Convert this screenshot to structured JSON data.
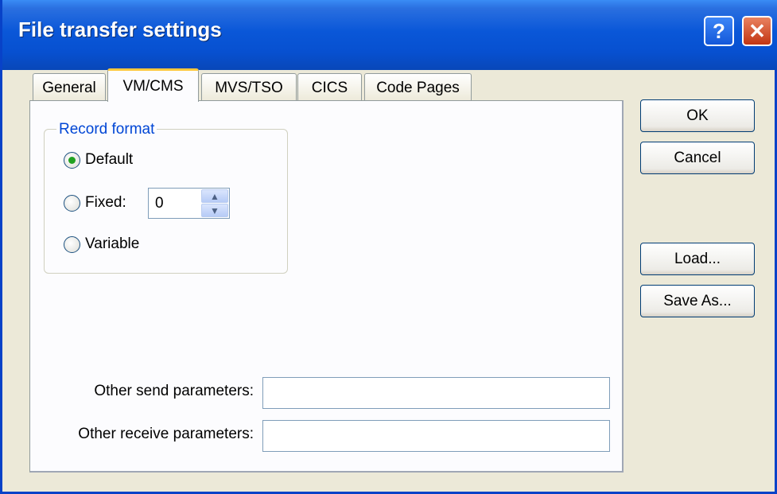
{
  "window": {
    "title": "File transfer settings"
  },
  "titlebar_buttons": {
    "help": "?",
    "close": "✕"
  },
  "tabs": [
    {
      "label": "General"
    },
    {
      "label": "VM/CMS"
    },
    {
      "label": "MVS/TSO"
    },
    {
      "label": "CICS"
    },
    {
      "label": "Code Pages"
    }
  ],
  "active_tab": "VM/CMS",
  "record_format": {
    "legend": "Record format",
    "options": [
      {
        "label": "Default",
        "checked": true
      },
      {
        "label": "Fixed:",
        "checked": false
      },
      {
        "label": "Variable",
        "checked": false
      }
    ],
    "fixed_value": "0"
  },
  "parameters": {
    "send_label": "Other send parameters:",
    "send_value": "",
    "receive_label": "Other receive parameters:",
    "receive_value": ""
  },
  "buttons": {
    "ok": "OK",
    "cancel": "Cancel",
    "load": "Load...",
    "save_as": "Save As..."
  },
  "colors": {
    "titlebar": "#0a57d8",
    "dialog_bg": "#ece9d8",
    "group_legend": "#0046d5",
    "active_tab_accent": "#ffc83c",
    "radio_dot": "#21a121"
  }
}
